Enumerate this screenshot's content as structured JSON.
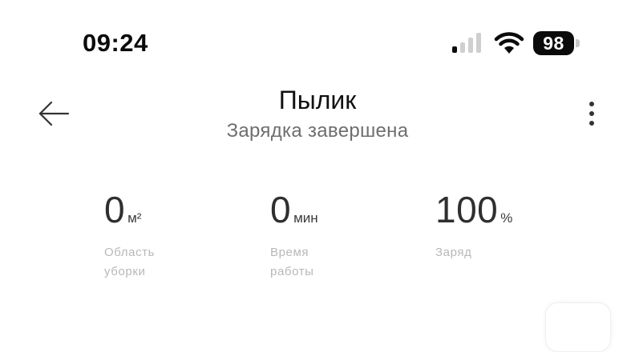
{
  "status_bar": {
    "time": "09:24",
    "battery_level": "98",
    "signal_bars_filled": 1,
    "signal_bars_total": 4
  },
  "header": {
    "title": "Пылик",
    "subtitle": "Зарядка завершена"
  },
  "stats": {
    "area": {
      "value": "0",
      "unit": "м²",
      "label_line1": "Область",
      "label_line2": "уборки"
    },
    "time": {
      "value": "0",
      "unit": "мин",
      "label_line1": "Время",
      "label_line2": "работы"
    },
    "charge": {
      "value": "100",
      "unit": "%",
      "label_line1": "Заряд"
    }
  },
  "icons": {
    "back": "arrow-left-icon",
    "more": "more-vertical-icon",
    "wifi": "wifi-icon",
    "signal": "signal-icon",
    "battery": "battery-icon"
  },
  "colors": {
    "background": "#ffffff",
    "title": "#111111",
    "subtitle": "#6e6e6e",
    "stat_value": "#2f2f2f",
    "stat_label": "#b8b8b8"
  }
}
